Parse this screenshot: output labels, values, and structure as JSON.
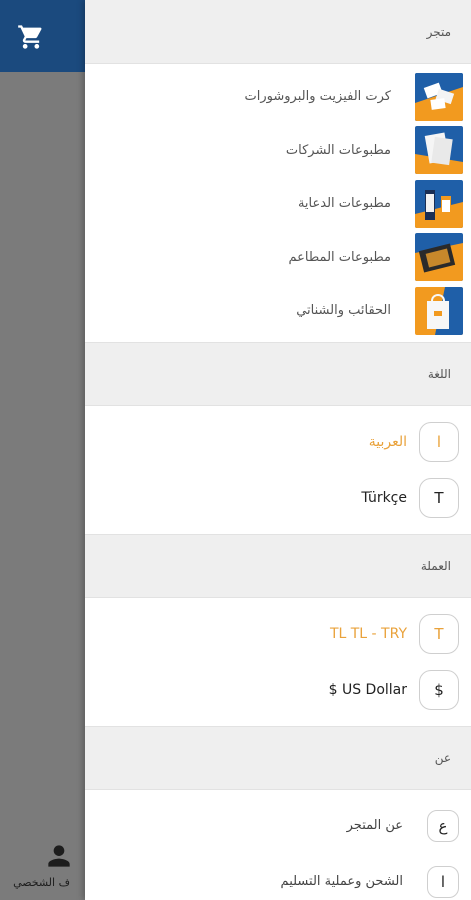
{
  "background": {
    "cart_icon": "shopping-cart-icon",
    "profile_icon": "person-icon",
    "profile_label": "ف الشخصي"
  },
  "drawer": {
    "store": {
      "header": "متجر",
      "items": [
        {
          "label": "كرت الفيزيت والبروشورات",
          "icon": "business-cards-thumbnail"
        },
        {
          "label": "مطبوعات الشركات",
          "icon": "corporate-print-thumbnail"
        },
        {
          "label": "مطبوعات الدعاية",
          "icon": "advertising-print-thumbnail"
        },
        {
          "label": "مطبوعات المطاعم",
          "icon": "restaurant-print-thumbnail"
        },
        {
          "label": "الحقائب والشناتي",
          "icon": "bags-thumbnail"
        }
      ]
    },
    "language": {
      "header": "اللغة",
      "items": [
        {
          "badge": "ا",
          "label": "العربية",
          "active": true
        },
        {
          "badge": "T",
          "label": "Türkçe",
          "active": false
        }
      ]
    },
    "currency": {
      "header": "العملة",
      "items": [
        {
          "badge": "T",
          "label": "TL TL - TRY",
          "active": true
        },
        {
          "badge": "$",
          "label": "$ US Dollar",
          "active": false
        }
      ]
    },
    "about": {
      "header": "عن",
      "items": [
        {
          "badge": "ع",
          "label": "عن المتجر"
        },
        {
          "badge": "ا",
          "label": "الشحن وعملية التسليم"
        }
      ]
    }
  },
  "colors": {
    "topbar": "#1b4a7e",
    "accent": "#e9a23b",
    "thumb_blue": "#1f5fa8",
    "thumb_orange": "#f29a1f"
  }
}
